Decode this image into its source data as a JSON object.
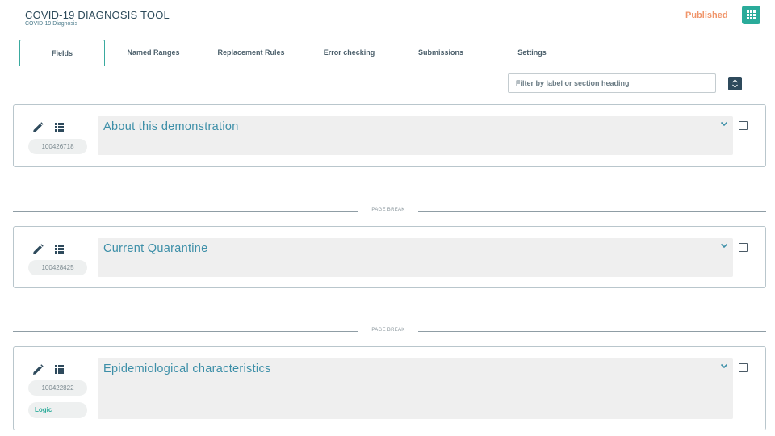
{
  "app": {
    "title": "COVID-19 DIAGNOSIS TOOL",
    "subtitle": "COVID-19 Diagnosis",
    "status": "Published",
    "accent_color": "#2aab9a",
    "status_color": "#f0956a"
  },
  "tabs": [
    {
      "label": "Fields",
      "active": true
    },
    {
      "label": "Named Ranges",
      "active": false
    },
    {
      "label": "Replacement Rules",
      "active": false
    },
    {
      "label": "Error checking",
      "active": false
    },
    {
      "label": "Submissions",
      "active": false
    },
    {
      "label": "Settings",
      "active": false
    }
  ],
  "filter": {
    "placeholder": "Filter by label or section heading",
    "value": ""
  },
  "page_break_label": "PAGE BREAK",
  "sections": [
    {
      "id": "100426718",
      "heading": "About this demonstration",
      "logic": null,
      "checked": false
    },
    {
      "id": "100428425",
      "heading": "Current Quarantine",
      "logic": null,
      "checked": false
    },
    {
      "id": "100422822",
      "heading": "Epidemiological characteristics",
      "logic": "Logic",
      "checked": false
    }
  ],
  "icons": {
    "header_menu": "grid-icon",
    "sort": "sort-icon",
    "edit": "pencil-icon",
    "drag": "drag-handle-icon",
    "expand": "chevron-down-icon",
    "select": "checkbox"
  }
}
